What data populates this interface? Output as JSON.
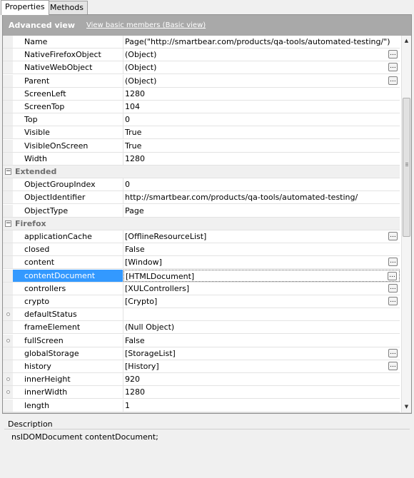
{
  "tabs": [
    {
      "label": "Properties"
    },
    {
      "label": "Methods"
    }
  ],
  "header": {
    "title": "Advanced view",
    "link": "View basic members (Basic view)"
  },
  "rows": [
    {
      "name": "Name",
      "value": "Page(\"http://smartbear.com/products/qa-tools/automated-testing/\")"
    },
    {
      "name": "NativeFirefoxObject",
      "value": "(Object)",
      "button": true
    },
    {
      "name": "NativeWebObject",
      "value": "(Object)",
      "button": true
    },
    {
      "name": "Parent",
      "value": "(Object)",
      "button": true
    },
    {
      "name": "ScreenLeft",
      "value": "1280"
    },
    {
      "name": "ScreenTop",
      "value": "104"
    },
    {
      "name": "Top",
      "value": "0"
    },
    {
      "name": "Visible",
      "value": "True"
    },
    {
      "name": "VisibleOnScreen",
      "value": "True"
    },
    {
      "name": "Width",
      "value": "1280"
    },
    {
      "category": "Extended"
    },
    {
      "name": "ObjectGroupIndex",
      "value": "0"
    },
    {
      "name": "ObjectIdentifier",
      "value": "http://smartbear.com/products/qa-tools/automated-testing/"
    },
    {
      "name": "ObjectType",
      "value": "Page"
    },
    {
      "category": "Firefox"
    },
    {
      "name": "applicationCache",
      "value": "[OfflineResourceList]",
      "button": true
    },
    {
      "name": "closed",
      "value": "False"
    },
    {
      "name": "content",
      "value": "[Window]",
      "button": true
    },
    {
      "name": "contentDocument",
      "value": "[HTMLDocument]",
      "button": true,
      "selected": true
    },
    {
      "name": "controllers",
      "value": "[XULControllers]",
      "button": true
    },
    {
      "name": "crypto",
      "value": "[Crypto]",
      "button": true
    },
    {
      "name": "defaultStatus",
      "value": "",
      "dot": true
    },
    {
      "name": "frameElement",
      "value": "(Null Object)"
    },
    {
      "name": "fullScreen",
      "value": "False",
      "dot": true
    },
    {
      "name": "globalStorage",
      "value": "[StorageList]",
      "button": true
    },
    {
      "name": "history",
      "value": "[History]",
      "button": true
    },
    {
      "name": "innerHeight",
      "value": "920",
      "dot": true
    },
    {
      "name": "innerWidth",
      "value": "1280",
      "dot": true
    },
    {
      "name": "length",
      "value": "1"
    }
  ],
  "ellipsis_label": "...",
  "collapse_glyph": "−",
  "scroll_up_glyph": "▲",
  "scroll_down_glyph": "▼",
  "description": {
    "label": "Description",
    "text": "nsIDOMDocument contentDocument;"
  }
}
